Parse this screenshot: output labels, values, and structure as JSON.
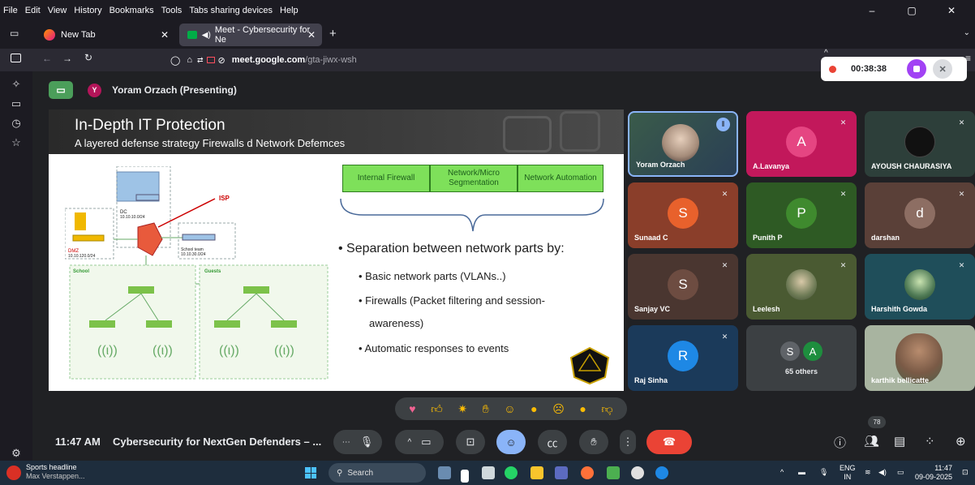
{
  "menubar": {
    "items": [
      "File",
      "Edit",
      "View",
      "History",
      "Bookmarks",
      "Tools",
      "Tabs sharing devices",
      "Help"
    ]
  },
  "tabs": [
    {
      "label": "New Tab"
    },
    {
      "label": "Meet - Cybersecurity for Ne"
    }
  ],
  "address": {
    "host": "meet.google.com",
    "path": "/gta-jiwx-wsh"
  },
  "meet": {
    "presenter_initial": "Y",
    "presenting_label": "Yoram Orzach (Presenting)",
    "recording_time": "00:38:38",
    "clock": "11:47 AM",
    "meeting_name": "Cybersecurity for NextGen Defenders – ...",
    "participant_count": "78"
  },
  "slide": {
    "title": "In-Depth IT Protection",
    "subtitle": "A layered defense strategy Firewalls d Network Defemces",
    "boxes": [
      "Internal Firewall",
      "Network/Micro Segmentation",
      "Network Automation"
    ],
    "main_bullet": "• Separation between network parts by:",
    "sub_bullets": [
      "• Basic network parts (VLANs..)",
      "• Firewalls (Packet filtering and session-",
      "awareness)",
      "• Automatic responses to events"
    ],
    "diagram": {
      "isp": "ISP",
      "dc": "DC",
      "dc_net": "10.10.10.0/24",
      "dmz": "DMZ",
      "dmz_net": "10.10.120.0/24",
      "school_team": "School team",
      "school_team_net": "10.10.30.0/24",
      "school": "School",
      "guests": "Guests"
    }
  },
  "participants": [
    {
      "name": "Yoram Orzach",
      "initial": "",
      "color": "#3b5566"
    },
    {
      "name": "A.Lavanya",
      "initial": "A",
      "color": "#c2185b"
    },
    {
      "name": "AYOUSH CHAURASIYA",
      "initial": "",
      "color": "#2d3f3a"
    },
    {
      "name": "Sunaad C",
      "initial": "S",
      "color": "#e8612c"
    },
    {
      "name": "Punith P",
      "initial": "P",
      "color": "#3f8a2e"
    },
    {
      "name": "darshan",
      "initial": "d",
      "color": "#8d6e63"
    },
    {
      "name": "Sanjay VC",
      "initial": "S",
      "color": "#6d4c41"
    },
    {
      "name": "Leelesh",
      "initial": "",
      "color": "#5b7a3f"
    },
    {
      "name": "Harshith Gowda",
      "initial": "",
      "color": "#1f4e5a"
    },
    {
      "name": "Raj Sinha",
      "initial": "R",
      "color": "#1e88e5"
    },
    {
      "name": "65 others",
      "initial": "",
      "color": "#3c4043"
    },
    {
      "name": "karthik bellicatte",
      "initial": "",
      "color": "#7b8a70"
    }
  ],
  "others_avatars": [
    "S",
    "A"
  ],
  "taskbar": {
    "news_title": "Sports headline",
    "news_sub": "Max Verstappen...",
    "search": "Search",
    "lang": "ENG",
    "region": "IN",
    "time": "11:47",
    "date": "09-09-2025"
  },
  "colors": {
    "meet_bg": "#202124",
    "accent_blue": "#8ab4f8",
    "end_call_red": "#ea4335",
    "rec_purple": "#a142f4"
  }
}
